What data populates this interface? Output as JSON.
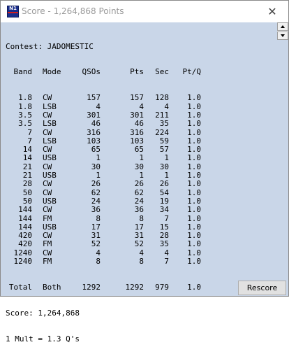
{
  "window": {
    "title": "Score - 1,264,868 Points",
    "close_glyph": "✕",
    "icon_text": "N1"
  },
  "report": {
    "contest_line": "Contest: JADOMESTIC",
    "header": {
      "band": "Band",
      "mode": "Mode",
      "qsos": "QSOs",
      "pts": "Pts",
      "sec": "Sec",
      "ptq": "Pt/Q"
    },
    "rows": [
      {
        "band": "1.8",
        "mode": "CW",
        "qsos": "157",
        "pts": "157",
        "sec": "128",
        "ptq": "1.0"
      },
      {
        "band": "1.8",
        "mode": "LSB",
        "qsos": "4",
        "pts": "4",
        "sec": "4",
        "ptq": "1.0"
      },
      {
        "band": "3.5",
        "mode": "CW",
        "qsos": "301",
        "pts": "301",
        "sec": "211",
        "ptq": "1.0"
      },
      {
        "band": "3.5",
        "mode": "LSB",
        "qsos": "46",
        "pts": "46",
        "sec": "35",
        "ptq": "1.0"
      },
      {
        "band": "7",
        "mode": "CW",
        "qsos": "316",
        "pts": "316",
        "sec": "224",
        "ptq": "1.0"
      },
      {
        "band": "7",
        "mode": "LSB",
        "qsos": "103",
        "pts": "103",
        "sec": "59",
        "ptq": "1.0"
      },
      {
        "band": "14",
        "mode": "CW",
        "qsos": "65",
        "pts": "65",
        "sec": "57",
        "ptq": "1.0"
      },
      {
        "band": "14",
        "mode": "USB",
        "qsos": "1",
        "pts": "1",
        "sec": "1",
        "ptq": "1.0"
      },
      {
        "band": "21",
        "mode": "CW",
        "qsos": "30",
        "pts": "30",
        "sec": "30",
        "ptq": "1.0"
      },
      {
        "band": "21",
        "mode": "USB",
        "qsos": "1",
        "pts": "1",
        "sec": "1",
        "ptq": "1.0"
      },
      {
        "band": "28",
        "mode": "CW",
        "qsos": "26",
        "pts": "26",
        "sec": "26",
        "ptq": "1.0"
      },
      {
        "band": "50",
        "mode": "CW",
        "qsos": "62",
        "pts": "62",
        "sec": "54",
        "ptq": "1.0"
      },
      {
        "band": "50",
        "mode": "USB",
        "qsos": "24",
        "pts": "24",
        "sec": "19",
        "ptq": "1.0"
      },
      {
        "band": "144",
        "mode": "CW",
        "qsos": "36",
        "pts": "36",
        "sec": "34",
        "ptq": "1.0"
      },
      {
        "band": "144",
        "mode": "FM",
        "qsos": "8",
        "pts": "8",
        "sec": "7",
        "ptq": "1.0"
      },
      {
        "band": "144",
        "mode": "USB",
        "qsos": "17",
        "pts": "17",
        "sec": "15",
        "ptq": "1.0"
      },
      {
        "band": "420",
        "mode": "CW",
        "qsos": "31",
        "pts": "31",
        "sec": "28",
        "ptq": "1.0"
      },
      {
        "band": "420",
        "mode": "FM",
        "qsos": "52",
        "pts": "52",
        "sec": "35",
        "ptq": "1.0"
      },
      {
        "band": "1240",
        "mode": "CW",
        "qsos": "4",
        "pts": "4",
        "sec": "4",
        "ptq": "1.0"
      },
      {
        "band": "1240",
        "mode": "FM",
        "qsos": "8",
        "pts": "8",
        "sec": "7",
        "ptq": "1.0"
      }
    ],
    "total": {
      "band": "Total",
      "mode": "Both",
      "qsos": "1292",
      "pts": "1292",
      "sec": "979",
      "ptq": "1.0"
    },
    "score_line": "Score: 1,264,868",
    "mult_line": "1 Mult = 1.3 Q's"
  },
  "buttons": {
    "rescore": "Rescore"
  },
  "colors": {
    "panel_bg": "#c9d6e8",
    "title_text": "#9a9a9a"
  },
  "icons": {
    "app": "n1mm-logo-icon",
    "close": "close-icon",
    "scroll_up": "scroll-up-arrow-icon",
    "scroll_down": "scroll-down-arrow-icon"
  }
}
